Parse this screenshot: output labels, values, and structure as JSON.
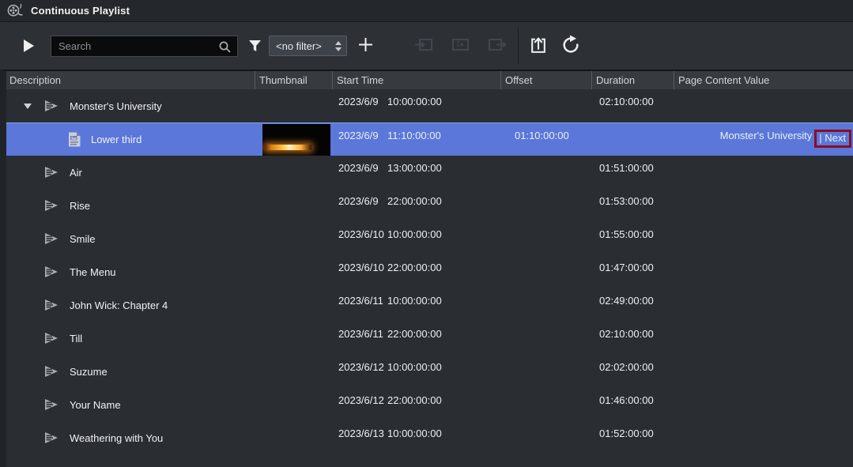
{
  "window": {
    "title": "Continuous Playlist",
    "icon": "film-reel-icon"
  },
  "toolbar": {
    "play_button": {
      "icon": "play-icon"
    },
    "search": {
      "placeholder": "Search",
      "icon": "search-icon"
    },
    "filter": {
      "icon": "filter-funnel-icon",
      "selected_option": "<no filter>",
      "spinner_icons": [
        "spinner-up-icon",
        "spinner-down-icon"
      ]
    },
    "add_button": {
      "icon": "plus-icon"
    },
    "disabled_buttons": [
      {
        "icon": "take-in-icon"
      },
      {
        "icon": "preview-icon"
      },
      {
        "icon": "take-out-icon"
      }
    ],
    "publish_button": {
      "icon": "publish-icon"
    },
    "refresh_button": {
      "icon": "refresh-icon"
    }
  },
  "table": {
    "columns": [
      "Description",
      "Thumbnail",
      "Start Time",
      "Offset",
      "Duration",
      "Page Content Value"
    ],
    "rows": [
      {
        "description": "Monster's University",
        "icon": "playlist-icon",
        "level": 0,
        "expanded": true,
        "selected": false,
        "thumbnail": false,
        "start_date": "2023/6/9",
        "start_time": "10:00:00:00",
        "offset": "",
        "duration": "02:10:00:00",
        "page_content_value": "",
        "page_content_value_highlighted": ""
      },
      {
        "description": "Lower third",
        "icon": "page-icon",
        "level": 1,
        "expanded": false,
        "selected": true,
        "thumbnail": true,
        "start_date": "2023/6/9",
        "start_time": "11:10:00:00",
        "offset": "01:10:00:00",
        "duration": "",
        "page_content_value": "Monster's University",
        "page_content_value_highlighted": "| Next"
      },
      {
        "description": "Air",
        "icon": "playlist-icon",
        "level": 0,
        "expanded": false,
        "selected": false,
        "thumbnail": false,
        "start_date": "2023/6/9",
        "start_time": "13:00:00:00",
        "offset": "",
        "duration": "01:51:00:00",
        "page_content_value": "",
        "page_content_value_highlighted": ""
      },
      {
        "description": "Rise",
        "icon": "playlist-icon",
        "level": 0,
        "expanded": false,
        "selected": false,
        "thumbnail": false,
        "start_date": "2023/6/9",
        "start_time": "22:00:00:00",
        "offset": "",
        "duration": "01:53:00:00",
        "page_content_value": "",
        "page_content_value_highlighted": ""
      },
      {
        "description": "Smile",
        "icon": "playlist-icon",
        "level": 0,
        "expanded": false,
        "selected": false,
        "thumbnail": false,
        "start_date": "2023/6/10",
        "start_time": "10:00:00:00",
        "offset": "",
        "duration": "01:55:00:00",
        "page_content_value": "",
        "page_content_value_highlighted": ""
      },
      {
        "description": "The Menu",
        "icon": "playlist-icon",
        "level": 0,
        "expanded": false,
        "selected": false,
        "thumbnail": false,
        "start_date": "2023/6/10",
        "start_time": "22:00:00:00",
        "offset": "",
        "duration": "01:47:00:00",
        "page_content_value": "",
        "page_content_value_highlighted": ""
      },
      {
        "description": "John Wick: Chapter 4",
        "icon": "playlist-icon",
        "level": 0,
        "expanded": false,
        "selected": false,
        "thumbnail": false,
        "start_date": "2023/6/11",
        "start_time": "10:00:00:00",
        "offset": "",
        "duration": "02:49:00:00",
        "page_content_value": "",
        "page_content_value_highlighted": ""
      },
      {
        "description": "Till",
        "icon": "playlist-icon",
        "level": 0,
        "expanded": false,
        "selected": false,
        "thumbnail": false,
        "start_date": "2023/6/11",
        "start_time": "22:00:00:00",
        "offset": "",
        "duration": "02:10:00:00",
        "page_content_value": "",
        "page_content_value_highlighted": ""
      },
      {
        "description": "Suzume",
        "icon": "playlist-icon",
        "level": 0,
        "expanded": false,
        "selected": false,
        "thumbnail": false,
        "start_date": "2023/6/12",
        "start_time": "10:00:00:00",
        "offset": "",
        "duration": "02:02:00:00",
        "page_content_value": "",
        "page_content_value_highlighted": ""
      },
      {
        "description": "Your Name",
        "icon": "playlist-icon",
        "level": 0,
        "expanded": false,
        "selected": false,
        "thumbnail": false,
        "start_date": "2023/6/12",
        "start_time": "22:00:00:00",
        "offset": "",
        "duration": "01:46:00:00",
        "page_content_value": "",
        "page_content_value_highlighted": ""
      },
      {
        "description": "Weathering with You",
        "icon": "playlist-icon",
        "level": 0,
        "expanded": false,
        "selected": false,
        "thumbnail": false,
        "start_date": "2023/6/13",
        "start_time": "10:00:00:00",
        "offset": "",
        "duration": "01:52:00:00",
        "page_content_value": "",
        "page_content_value_highlighted": ""
      }
    ]
  },
  "colors": {
    "selection_blue": "#5a77d9",
    "annotation_red": "#8c0e1d",
    "background": "#2a2e33",
    "header_background": "#373a3f"
  }
}
